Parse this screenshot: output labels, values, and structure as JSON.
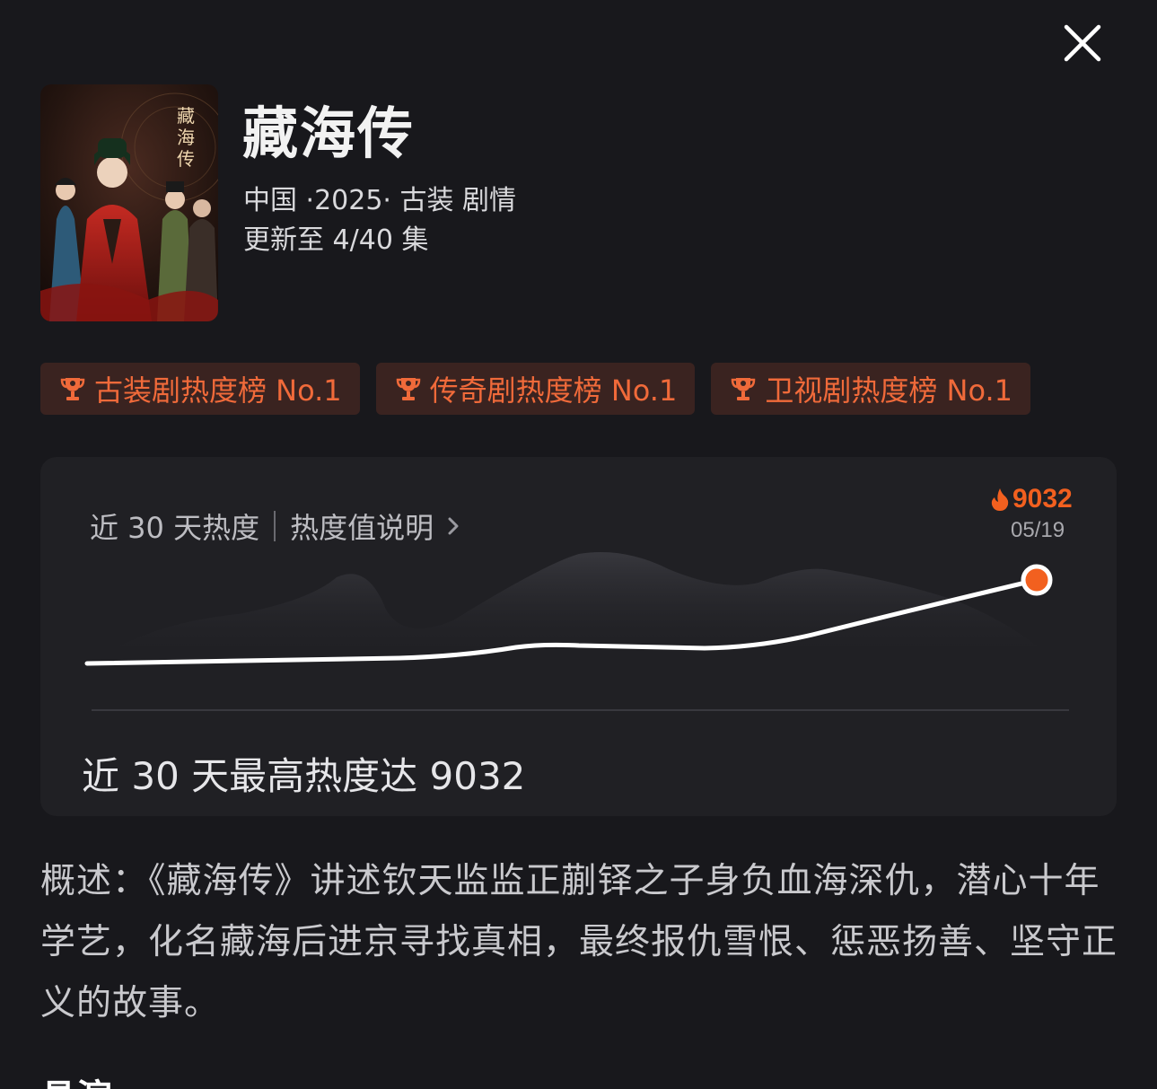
{
  "header": {
    "title": "藏海传",
    "meta_line": "中国 ·2025· 古装 剧情",
    "update_line": "更新至 4/40 集"
  },
  "poster": {
    "calligraphy": "藏海传"
  },
  "badges": [
    {
      "label": "古装剧热度榜 No.1"
    },
    {
      "label": "传奇剧热度榜 No.1"
    },
    {
      "label": "卫视剧热度榜 No.1"
    }
  ],
  "heat": {
    "header_label": "近 30 天热度",
    "info_link": "热度值说明",
    "peak_value": "9032",
    "peak_date": "05/19",
    "summary": "近 30 天最高热度达 9032"
  },
  "description": "概述：《藏海传》讲述钦天监监正蒯铎之子身负血海深仇，潜心十年学艺，化名藏海后进京寻找真相，最终报仇雪恨、惩恶扬善、坚守正义的故事。",
  "cast_title": "具演",
  "colors": {
    "background": "#18181c",
    "card": "#202024",
    "accent": "#f2601f",
    "badge_bg": "#3a2320",
    "badge_text": "#f06a3a"
  }
}
